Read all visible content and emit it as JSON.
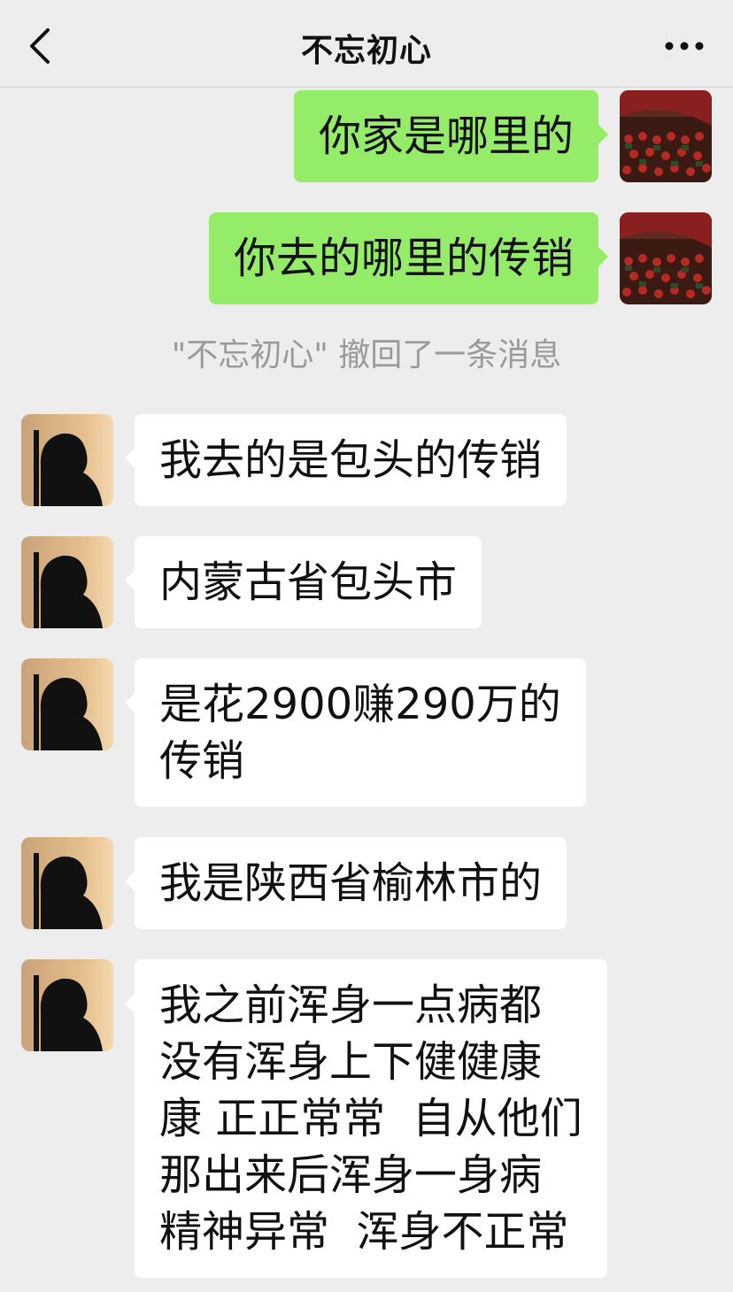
{
  "header": {
    "title": "不忘初心",
    "back_icon": "chevron-left-icon",
    "more_icon": "more-dots-icon"
  },
  "system_notice": "\"不忘初心\" 撤回了一条消息",
  "messages": [
    {
      "side": "me",
      "text": "你家是哪里的"
    },
    {
      "side": "me",
      "text": "你去的哪里的传销"
    },
    {
      "side": "them",
      "text": "我去的是包头的传销"
    },
    {
      "side": "them",
      "text": "内蒙古省包头市"
    },
    {
      "side": "them",
      "text": "是花2900赚290万的\n传销"
    },
    {
      "side": "them",
      "text": "我是陕西省榆林市的"
    },
    {
      "side": "them",
      "text": "我之前浑身一点病都\n没有浑身上下健健康\n康 正正常常  自从他们\n那出来后浑身一身病\n精神异常  浑身不正常"
    }
  ],
  "colors": {
    "my_bubble": "#95ec69",
    "their_bubble": "#ffffff",
    "background": "#ededed",
    "system_text": "#9a9a9a"
  }
}
